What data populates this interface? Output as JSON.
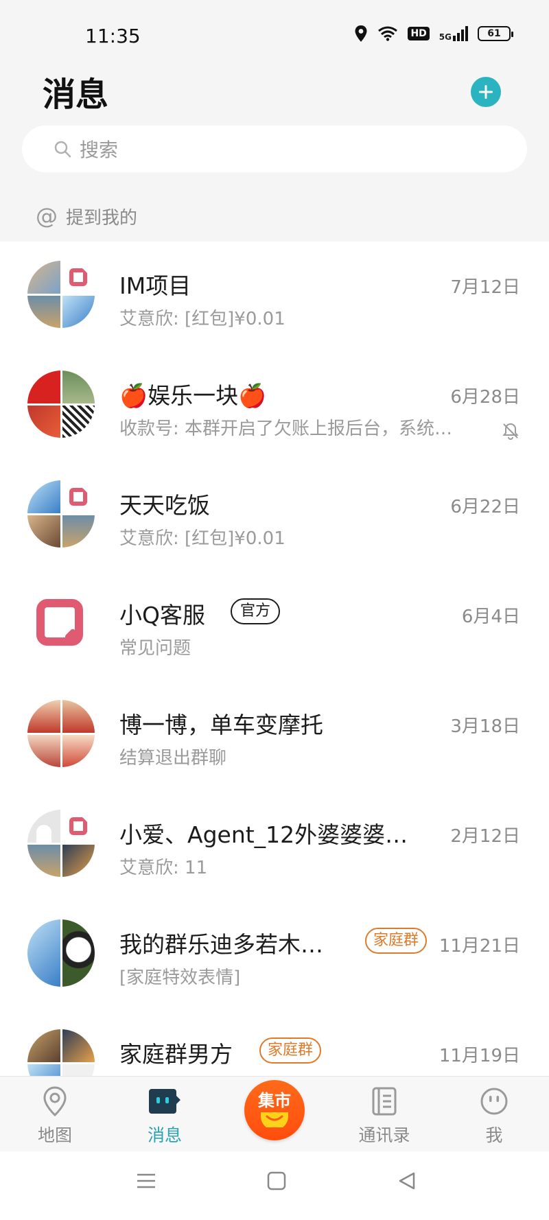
{
  "status_bar": {
    "time": "11:35",
    "network": "5G",
    "hd": "HD",
    "battery": "61"
  },
  "header": {
    "title": "消息"
  },
  "search": {
    "placeholder": "搜索"
  },
  "mention": {
    "label": "提到我的"
  },
  "conversations": [
    {
      "name": "IM项目",
      "preview": "艾意欣: [红包]¥0.01",
      "date": "7月12日"
    },
    {
      "name": "🍎娱乐一块🍎",
      "preview": "收款号: 本群开启了欠账上报后台，系统…",
      "date": "6月28日",
      "muted": true
    },
    {
      "name": "天天吃饭",
      "preview": "艾意欣: [红包]¥0.01",
      "date": "6月22日"
    },
    {
      "name": "小Q客服",
      "tag": "官方",
      "preview": "常见问题",
      "date": "6月4日"
    },
    {
      "name": "博一博，单车变摩托",
      "preview": "结算退出群聊",
      "date": "3月18日"
    },
    {
      "name": "小爱、Agent_12外婆婆婆…",
      "preview": "艾意欣: 11",
      "date": "2月12日"
    },
    {
      "name": "我的群乐迪多若木…",
      "tag": "家庭群",
      "preview": "[家庭特效表情]",
      "date": "11月21日"
    },
    {
      "name": "家庭群男方",
      "tag": "家庭群",
      "preview": "",
      "date": "11月19日"
    }
  ],
  "tabs": [
    {
      "label": "地图"
    },
    {
      "label": "消息"
    },
    {
      "label": "集市"
    },
    {
      "label": "通讯录"
    },
    {
      "label": "我"
    }
  ],
  "colors": {
    "accent": "#2bb3c0",
    "family_tag": "#e07a2b",
    "market": "#ff5a14"
  }
}
